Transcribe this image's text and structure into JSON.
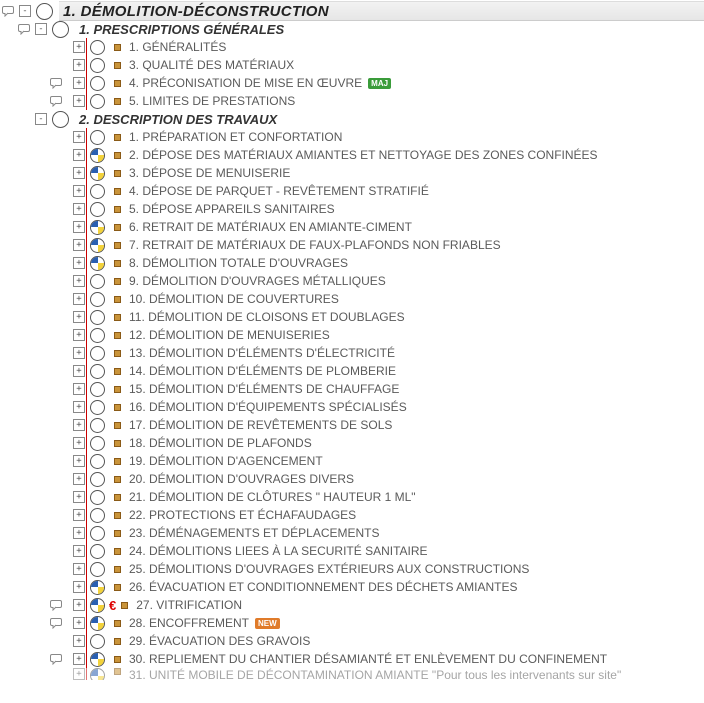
{
  "colors": {
    "blue": "#2a5fb0",
    "yellow": "#f3d23a",
    "treeLine": "#c00000"
  },
  "badges": {
    "maj": "MAJ",
    "new": "NEW"
  },
  "root": {
    "num": "1.",
    "title": "DÉMOLITION-DÉCONSTRUCTION"
  },
  "sections": [
    {
      "num": "1.",
      "title": "PRESCRIPTIONS GÉNÉRALES",
      "hasSpeech": true,
      "expander": "-",
      "items": [
        {
          "num": "1.",
          "title": "GÉNÉRALITÉS",
          "speech": false,
          "pie": "none"
        },
        {
          "num": "3.",
          "title": "QUALITÉ DES MATÉRIAUX",
          "speech": false,
          "pie": "none"
        },
        {
          "num": "4.",
          "title": "PRÉCONISATION DE MISE EN ŒUVRE",
          "speech": true,
          "pie": "none",
          "badge": "maj"
        },
        {
          "num": "5.",
          "title": "LIMITES DE PRESTATIONS",
          "speech": true,
          "pie": "none"
        }
      ]
    },
    {
      "num": "2.",
      "title": "DESCRIPTION DES TRAVAUX",
      "hasSpeech": false,
      "expander": "-",
      "items": [
        {
          "num": "1.",
          "title": "PRÉPARATION ET CONFORTATION",
          "pie": "none"
        },
        {
          "num": "2.",
          "title": "DÉPOSE DES MATÉRIAUX AMIANTES ET NETTOYAGE DES ZONES CONFINÉES",
          "pie": "by"
        },
        {
          "num": "3.",
          "title": "DÉPOSE DE MENUISERIE",
          "pie": "by"
        },
        {
          "num": "4.",
          "title": "DÉPOSE DE PARQUET - REVÊTEMENT STRATIFIÉ",
          "pie": "none"
        },
        {
          "num": "5.",
          "title": "DÉPOSE APPAREILS SANITAIRES",
          "pie": "none"
        },
        {
          "num": "6.",
          "title": "RETRAIT DE MATÉRIAUX EN AMIANTE-CIMENT",
          "pie": "by"
        },
        {
          "num": "7.",
          "title": "RETRAIT DE MATÉRIAUX DE FAUX-PLAFONDS NON FRIABLES",
          "pie": "by"
        },
        {
          "num": "8.",
          "title": "DÉMOLITION TOTALE D'OUVRAGES",
          "pie": "by"
        },
        {
          "num": "9.",
          "title": "DÉMOLITION D'OUVRAGES MÉTALLIQUES",
          "pie": "none"
        },
        {
          "num": "10.",
          "title": "DÉMOLITION DE COUVERTURES",
          "pie": "none"
        },
        {
          "num": "11.",
          "title": "DÉMOLITION DE CLOISONS ET DOUBLAGES",
          "pie": "none"
        },
        {
          "num": "12.",
          "title": "DÉMOLITION DE MENUISERIES",
          "pie": "none"
        },
        {
          "num": "13.",
          "title": "DÉMOLITION D'ÉLÉMENTS D'ÉLECTRICITÉ",
          "pie": "none"
        },
        {
          "num": "14.",
          "title": "DÉMOLITION D'ÉLÉMENTS DE PLOMBERIE",
          "pie": "none"
        },
        {
          "num": "15.",
          "title": "DÉMOLITION D'ÉLÉMENTS DE CHAUFFAGE",
          "pie": "none"
        },
        {
          "num": "16.",
          "title": "DÉMOLITION D'ÉQUIPEMENTS SPÉCIALISÉS",
          "pie": "none"
        },
        {
          "num": "17.",
          "title": "DÉMOLITION DE REVÊTEMENTS DE SOLS",
          "pie": "none"
        },
        {
          "num": "18.",
          "title": "DÉMOLITION DE PLAFONDS",
          "pie": "none"
        },
        {
          "num": "19.",
          "title": "DÉMOLITION D'AGENCEMENT",
          "pie": "none"
        },
        {
          "num": "20.",
          "title": "DÉMOLITION D'OUVRAGES DIVERS",
          "pie": "none"
        },
        {
          "num": "21.",
          "title": "DÉMOLITION DE CLÔTURES \" HAUTEUR 1 ML\"",
          "pie": "none"
        },
        {
          "num": "22.",
          "title": "PROTECTIONS ET ÉCHAFAUDAGES",
          "pie": "none"
        },
        {
          "num": "23.",
          "title": "DÉMÉNAGEMENTS ET DÉPLACEMENTS",
          "pie": "none"
        },
        {
          "num": "24.",
          "title": "DÉMOLITIONS LIEES À LA SECURITÉ SANITAIRE",
          "pie": "none"
        },
        {
          "num": "25.",
          "title": "DÉMOLITIONS D'OUVRAGES EXTÉRIEURS AUX CONSTRUCTIONS",
          "pie": "none"
        },
        {
          "num": "26.",
          "title": "ÉVACUATION  ET CONDITIONNEMENT DES DÉCHETS AMIANTES",
          "pie": "by"
        },
        {
          "num": "27.",
          "title": "VITRIFICATION",
          "pie": "by",
          "speech": true,
          "euro": true
        },
        {
          "num": "28.",
          "title": "ENCOFFREMENT",
          "pie": "by",
          "speech": true,
          "badge": "new"
        },
        {
          "num": "29.",
          "title": "ÉVACUATION DES GRAVOIS",
          "pie": "none"
        },
        {
          "num": "30.",
          "title": "REPLIEMENT DU CHANTIER DÉSAMIANTÉ ET ENLÈVEMENT DU CONFINEMENT",
          "pie": "by",
          "speech": true
        },
        {
          "num": "31.",
          "title": "UNITÉ MOBILE DE DÉCONTAMINATION AMIANTE \"Pour tous les intervenants sur site\"",
          "pie": "by",
          "cut": true
        }
      ]
    }
  ]
}
